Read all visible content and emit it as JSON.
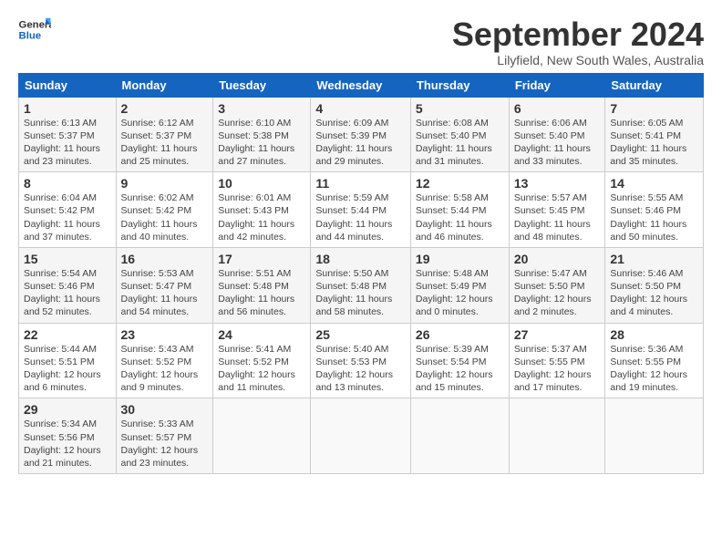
{
  "logo": {
    "general": "General",
    "blue": "Blue"
  },
  "header": {
    "month": "September 2024",
    "location": "Lilyfield, New South Wales, Australia"
  },
  "weekdays": [
    "Sunday",
    "Monday",
    "Tuesday",
    "Wednesday",
    "Thursday",
    "Friday",
    "Saturday"
  ],
  "weeks": [
    [
      {
        "day": "1",
        "info": "Sunrise: 6:13 AM\nSunset: 5:37 PM\nDaylight: 11 hours\nand 23 minutes."
      },
      {
        "day": "2",
        "info": "Sunrise: 6:12 AM\nSunset: 5:37 PM\nDaylight: 11 hours\nand 25 minutes."
      },
      {
        "day": "3",
        "info": "Sunrise: 6:10 AM\nSunset: 5:38 PM\nDaylight: 11 hours\nand 27 minutes."
      },
      {
        "day": "4",
        "info": "Sunrise: 6:09 AM\nSunset: 5:39 PM\nDaylight: 11 hours\nand 29 minutes."
      },
      {
        "day": "5",
        "info": "Sunrise: 6:08 AM\nSunset: 5:40 PM\nDaylight: 11 hours\nand 31 minutes."
      },
      {
        "day": "6",
        "info": "Sunrise: 6:06 AM\nSunset: 5:40 PM\nDaylight: 11 hours\nand 33 minutes."
      },
      {
        "day": "7",
        "info": "Sunrise: 6:05 AM\nSunset: 5:41 PM\nDaylight: 11 hours\nand 35 minutes."
      }
    ],
    [
      {
        "day": "8",
        "info": "Sunrise: 6:04 AM\nSunset: 5:42 PM\nDaylight: 11 hours\nand 37 minutes."
      },
      {
        "day": "9",
        "info": "Sunrise: 6:02 AM\nSunset: 5:42 PM\nDaylight: 11 hours\nand 40 minutes."
      },
      {
        "day": "10",
        "info": "Sunrise: 6:01 AM\nSunset: 5:43 PM\nDaylight: 11 hours\nand 42 minutes."
      },
      {
        "day": "11",
        "info": "Sunrise: 5:59 AM\nSunset: 5:44 PM\nDaylight: 11 hours\nand 44 minutes."
      },
      {
        "day": "12",
        "info": "Sunrise: 5:58 AM\nSunset: 5:44 PM\nDaylight: 11 hours\nand 46 minutes."
      },
      {
        "day": "13",
        "info": "Sunrise: 5:57 AM\nSunset: 5:45 PM\nDaylight: 11 hours\nand 48 minutes."
      },
      {
        "day": "14",
        "info": "Sunrise: 5:55 AM\nSunset: 5:46 PM\nDaylight: 11 hours\nand 50 minutes."
      }
    ],
    [
      {
        "day": "15",
        "info": "Sunrise: 5:54 AM\nSunset: 5:46 PM\nDaylight: 11 hours\nand 52 minutes."
      },
      {
        "day": "16",
        "info": "Sunrise: 5:53 AM\nSunset: 5:47 PM\nDaylight: 11 hours\nand 54 minutes."
      },
      {
        "day": "17",
        "info": "Sunrise: 5:51 AM\nSunset: 5:48 PM\nDaylight: 11 hours\nand 56 minutes."
      },
      {
        "day": "18",
        "info": "Sunrise: 5:50 AM\nSunset: 5:48 PM\nDaylight: 11 hours\nand 58 minutes."
      },
      {
        "day": "19",
        "info": "Sunrise: 5:48 AM\nSunset: 5:49 PM\nDaylight: 12 hours\nand 0 minutes."
      },
      {
        "day": "20",
        "info": "Sunrise: 5:47 AM\nSunset: 5:50 PM\nDaylight: 12 hours\nand 2 minutes."
      },
      {
        "day": "21",
        "info": "Sunrise: 5:46 AM\nSunset: 5:50 PM\nDaylight: 12 hours\nand 4 minutes."
      }
    ],
    [
      {
        "day": "22",
        "info": "Sunrise: 5:44 AM\nSunset: 5:51 PM\nDaylight: 12 hours\nand 6 minutes."
      },
      {
        "day": "23",
        "info": "Sunrise: 5:43 AM\nSunset: 5:52 PM\nDaylight: 12 hours\nand 9 minutes."
      },
      {
        "day": "24",
        "info": "Sunrise: 5:41 AM\nSunset: 5:52 PM\nDaylight: 12 hours\nand 11 minutes."
      },
      {
        "day": "25",
        "info": "Sunrise: 5:40 AM\nSunset: 5:53 PM\nDaylight: 12 hours\nand 13 minutes."
      },
      {
        "day": "26",
        "info": "Sunrise: 5:39 AM\nSunset: 5:54 PM\nDaylight: 12 hours\nand 15 minutes."
      },
      {
        "day": "27",
        "info": "Sunrise: 5:37 AM\nSunset: 5:55 PM\nDaylight: 12 hours\nand 17 minutes."
      },
      {
        "day": "28",
        "info": "Sunrise: 5:36 AM\nSunset: 5:55 PM\nDaylight: 12 hours\nand 19 minutes."
      }
    ],
    [
      {
        "day": "29",
        "info": "Sunrise: 5:34 AM\nSunset: 5:56 PM\nDaylight: 12 hours\nand 21 minutes."
      },
      {
        "day": "30",
        "info": "Sunrise: 5:33 AM\nSunset: 5:57 PM\nDaylight: 12 hours\nand 23 minutes."
      },
      {
        "day": "",
        "info": ""
      },
      {
        "day": "",
        "info": ""
      },
      {
        "day": "",
        "info": ""
      },
      {
        "day": "",
        "info": ""
      },
      {
        "day": "",
        "info": ""
      }
    ]
  ]
}
